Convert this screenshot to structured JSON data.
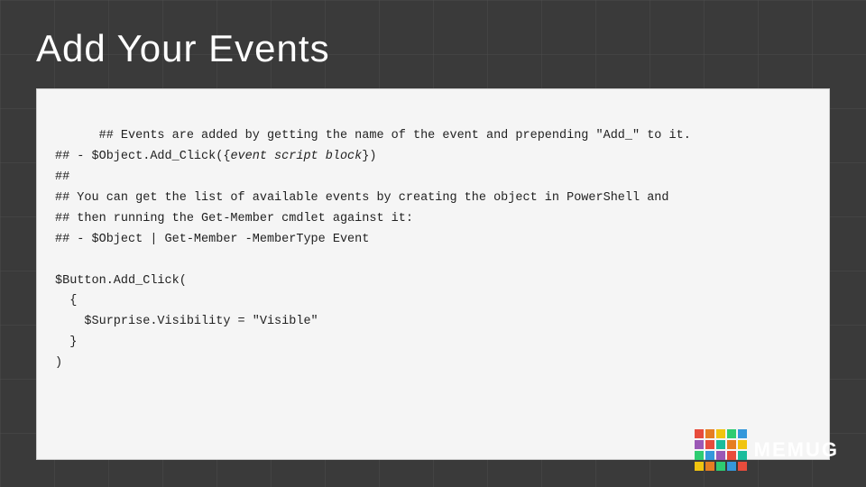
{
  "slide": {
    "title": "Add Your Events",
    "background_color": "#3a3a3a"
  },
  "code": {
    "lines": [
      {
        "text": "## Events are added by getting the name of the event and prepending \"Add_\" to it.",
        "italic": false
      },
      {
        "text": "## - $Object.Add_Click({event script block})",
        "italic": true,
        "italic_part": "{event script block}"
      },
      {
        "text": "##",
        "italic": false
      },
      {
        "text": "## You can get the list of available events by creating the object in PowerShell and",
        "italic": false
      },
      {
        "text": "## then running the Get-Member cmdlet against it:",
        "italic": false
      },
      {
        "text": "## - $Object | Get-Member -MemberType Event",
        "italic": false
      },
      {
        "text": "",
        "italic": false
      },
      {
        "text": "$Button.Add_Click(",
        "italic": false
      },
      {
        "text": "  {",
        "italic": false
      },
      {
        "text": "    $Surprise.Visibility = \"Visible\"",
        "italic": false
      },
      {
        "text": "  }",
        "italic": false
      },
      {
        "text": ")",
        "italic": false
      }
    ]
  },
  "memug": {
    "label": "MEMUG",
    "colors": [
      "#e74c3c",
      "#e67e22",
      "#f1c40f",
      "#2ecc71",
      "#3498db",
      "#9b59b6",
      "#1abc9c",
      "#e74c3c",
      "#e67e22",
      "#f1c40f",
      "#2ecc71",
      "#3498db",
      "#9b59b6",
      "#1abc9c",
      "#e74c3c",
      "#e67e22",
      "#f1c40f",
      "#f1c40f",
      "#2ecc71",
      "#3498db"
    ]
  }
}
